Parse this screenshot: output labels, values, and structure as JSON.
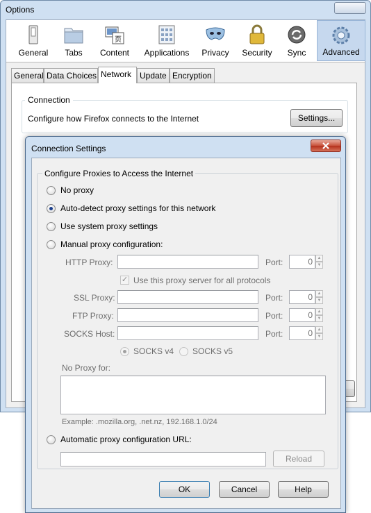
{
  "options_window": {
    "title": "Options",
    "panes": [
      {
        "label": "General",
        "icon": "switch-icon"
      },
      {
        "label": "Tabs",
        "icon": "folder-tabs-icon"
      },
      {
        "label": "Content",
        "icon": "content-icon"
      },
      {
        "label": "Applications",
        "icon": "applications-icon"
      },
      {
        "label": "Privacy",
        "icon": "mask-icon"
      },
      {
        "label": "Security",
        "icon": "padlock-icon"
      },
      {
        "label": "Sync",
        "icon": "sync-icon"
      },
      {
        "label": "Advanced",
        "icon": "gear-icon"
      }
    ],
    "selected_pane": "Advanced",
    "tabs": [
      "General",
      "Data Choices",
      "Network",
      "Update",
      "Encryption"
    ],
    "selected_tab": "Network",
    "connection": {
      "caption": "Connection",
      "description": "Configure how Firefox connects to the Internet",
      "settings_button": "Settings..."
    }
  },
  "connection_dialog": {
    "title": "Connection Settings",
    "group_caption": "Configure Proxies to Access the Internet",
    "options": {
      "no_proxy": "No proxy",
      "auto_detect": "Auto-detect proxy settings for this network",
      "system_proxy": "Use system proxy settings",
      "manual": "Manual proxy configuration:",
      "auto_url": "Automatic proxy configuration URL:"
    },
    "selected_option": "auto_detect",
    "manual": {
      "http_label": "HTTP Proxy:",
      "ssl_label": "SSL Proxy:",
      "ftp_label": "FTP Proxy:",
      "socks_label": "SOCKS Host:",
      "port_label": "Port:",
      "http_port": "0",
      "ssl_port": "0",
      "ftp_port": "0",
      "socks_port": "0",
      "share_label": "Use this proxy server for all protocols",
      "share_checked": true,
      "socks_v4": "SOCKS v4",
      "socks_v5": "SOCKS v5",
      "no_proxy_for_label": "No Proxy for:",
      "example": "Example: .mozilla.org, .net.nz, 192.168.1.0/24"
    },
    "reload_button": "Reload",
    "ok_button": "OK",
    "cancel_button": "Cancel",
    "help_button": "Help"
  },
  "colors": {
    "window_frame": "#cfe0f2",
    "selected_pane": "#c6d8ee",
    "close_button": "#c7503a"
  }
}
